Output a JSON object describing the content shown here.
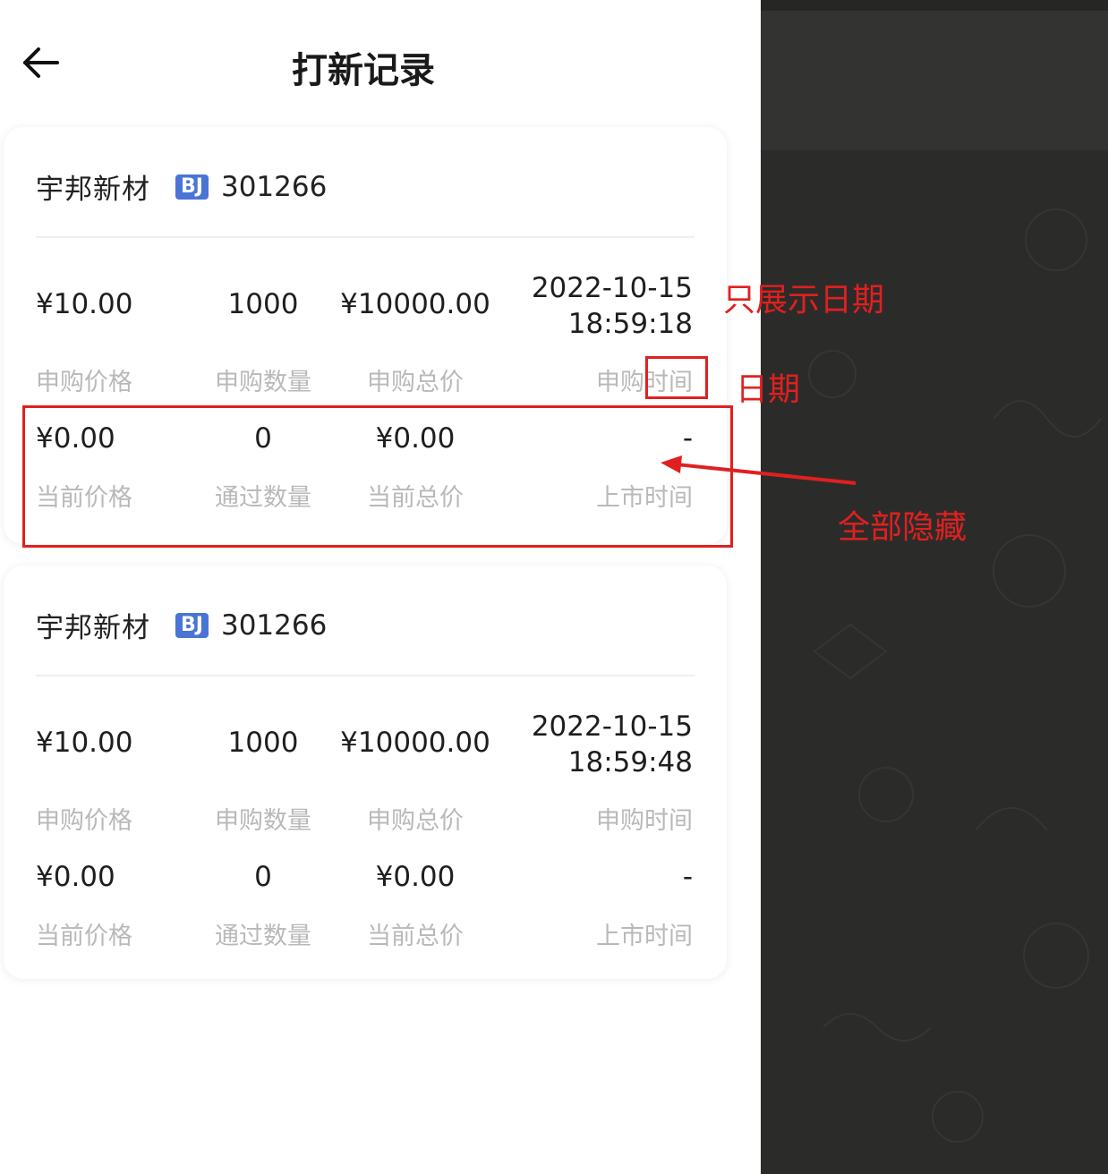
{
  "header": {
    "title": "打新记录"
  },
  "labels": {
    "subscribe_price": "申购价格",
    "subscribe_qty": "申购数量",
    "subscribe_total": "申购总价",
    "subscribe_time": "申购时间",
    "current_price": "当前价格",
    "pass_qty": "通过数量",
    "current_total": "当前总价",
    "listing_time": "上市时间"
  },
  "records": [
    {
      "name": "宇邦新材",
      "market": "BJ",
      "code": "301266",
      "subscribe_price": "¥10.00",
      "subscribe_qty": "1000",
      "subscribe_total": "¥10000.00",
      "subscribe_date": "2022-10-15",
      "subscribe_clock": "18:59:18",
      "current_price": "¥0.00",
      "pass_qty": "0",
      "current_total": "¥0.00",
      "listing_time": "-"
    },
    {
      "name": "宇邦新材",
      "market": "BJ",
      "code": "301266",
      "subscribe_price": "¥10.00",
      "subscribe_qty": "1000",
      "subscribe_total": "¥10000.00",
      "subscribe_date": "2022-10-15",
      "subscribe_clock": "18:59:48",
      "current_price": "¥0.00",
      "pass_qty": "0",
      "current_total": "¥0.00",
      "listing_time": "-"
    }
  ],
  "annotations": {
    "date_only": "只展示日期",
    "date": "日期",
    "hide_all": "全部隐藏"
  },
  "colors": {
    "annotation": "#e02020",
    "badge": "#4a74d6",
    "dark_panel": "#2b2c2a"
  },
  "icons": {
    "back": "arrow-left-icon"
  }
}
